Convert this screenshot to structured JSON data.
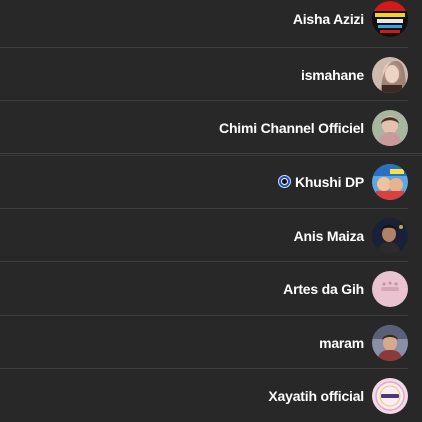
{
  "channels": [
    {
      "name": "Aisha Azizi",
      "avatar_icon": "aisha-azizi-avatar"
    },
    {
      "name": "ismahane",
      "avatar_icon": "ismahane-avatar"
    },
    {
      "name": "Chimi Channel Officiel",
      "avatar_icon": "chimi-channel-avatar"
    },
    {
      "name": "Khushi DP",
      "avatar_icon": "khushi-dp-avatar",
      "prefix_icon": "nazar-eye-icon"
    },
    {
      "name": "Anis Maiza",
      "avatar_icon": "anis-maiza-avatar"
    },
    {
      "name": "Artes da Gih",
      "avatar_icon": "artes-da-gih-avatar"
    },
    {
      "name": "maram",
      "avatar_icon": "maram-avatar"
    },
    {
      "name": "Xayatih official",
      "avatar_icon": "xayatih-official-avatar"
    }
  ],
  "colors": {
    "background": "#282828",
    "text": "#ffffff",
    "divider": "#3f3f3f"
  }
}
